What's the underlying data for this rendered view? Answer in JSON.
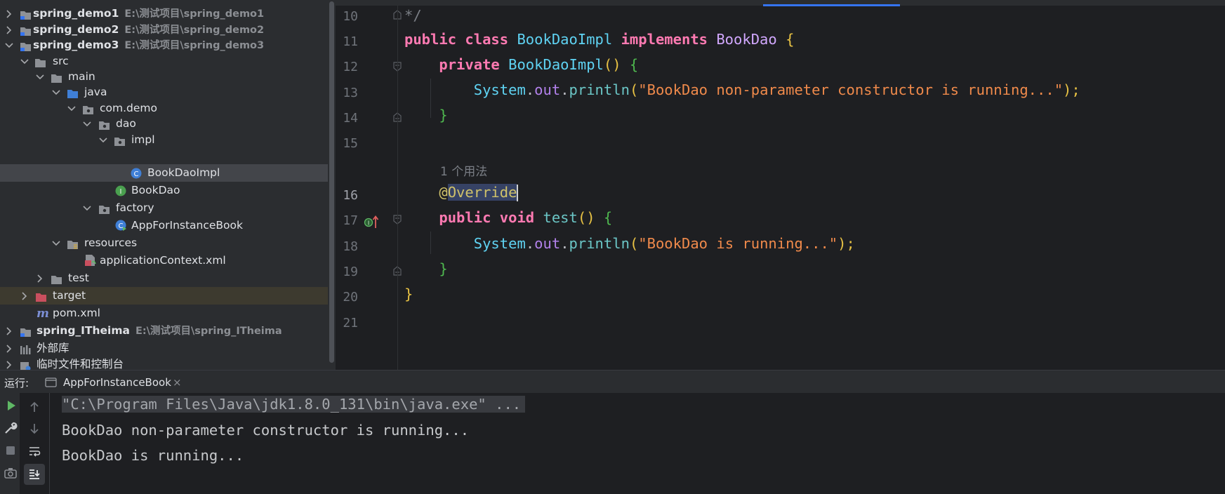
{
  "tree": {
    "items": [
      {
        "name": "spring_demo1",
        "path": "E:\\测试项目\\spring_demo1"
      },
      {
        "name": "spring_demo2",
        "path": "E:\\测试项目\\spring_demo2"
      },
      {
        "name": "spring_demo3",
        "path": "E:\\测试项目\\spring_demo3"
      },
      {
        "name": "src"
      },
      {
        "name": "main"
      },
      {
        "name": "java"
      },
      {
        "name": "com.demo"
      },
      {
        "name": "dao"
      },
      {
        "name": "impl"
      },
      {
        "name": "BookDaoImpl"
      },
      {
        "name": "BookDao"
      },
      {
        "name": "factory"
      },
      {
        "name": "AppForInstanceBook"
      },
      {
        "name": "resources"
      },
      {
        "name": "applicationContext.xml"
      },
      {
        "name": "test"
      },
      {
        "name": "target"
      },
      {
        "name": "pom.xml"
      },
      {
        "name": "spring_ITheima",
        "path": "E:\\测试项目\\spring_ITheima"
      },
      {
        "name": "外部库"
      },
      {
        "name": "临时文件和控制台"
      }
    ]
  },
  "editor": {
    "line_numbers": [
      "10",
      "11",
      "12",
      "13",
      "14",
      "15",
      "16",
      "17",
      "18",
      "19",
      "20",
      "21"
    ],
    "usage_hint": "1 个用法",
    "code": {
      "l10": "*/",
      "kw_public": "public",
      "kw_class": "class",
      "class_name": "BookDaoImpl",
      "kw_implements": "implements",
      "iface_name": "BookDao",
      "brace_open": "{",
      "brace_close": "}",
      "kw_private": "private",
      "ctor_name": "BookDaoImpl",
      "parens": "()",
      "system": "System",
      "dot": ".",
      "out": "out",
      "println": "println",
      "paren_open": "(",
      "paren_close_semi": ");",
      "str_ctor": "\"BookDao non-parameter constructor is running...\"",
      "annotation_at": "@",
      "annotation_name": "Override",
      "kw_void": "void",
      "method_name": "test",
      "str_test": "\"BookDao is running...\""
    }
  },
  "run": {
    "label": "运行:",
    "tab_label": "AppForInstanceBook",
    "tab_close": "×",
    "output": [
      "\"C:\\Program Files\\Java\\jdk1.8.0_131\\bin\\java.exe\" ...",
      "BookDao non-parameter constructor is running...",
      "BookDao is running..."
    ]
  },
  "colors": {
    "accent": "#3574f0",
    "run_green": "#5fb865",
    "folder": "#8e9196",
    "excluded_folder": "#c94f5e"
  }
}
